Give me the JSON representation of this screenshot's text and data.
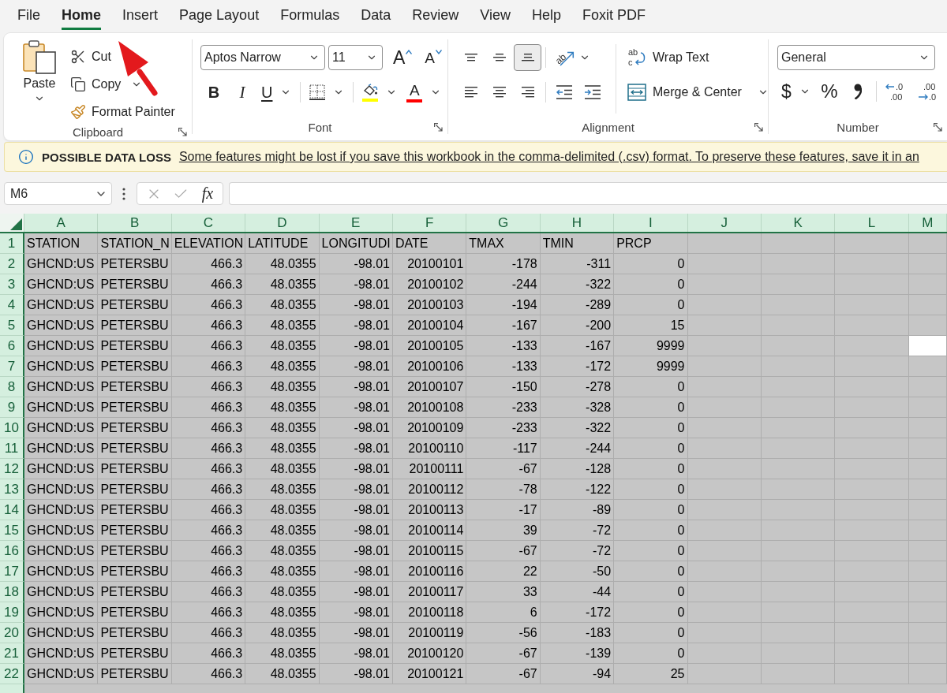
{
  "menu_tabs": [
    {
      "label": "File",
      "selected": false
    },
    {
      "label": "Home",
      "selected": true
    },
    {
      "label": "Insert",
      "selected": false
    },
    {
      "label": "Page Layout",
      "selected": false
    },
    {
      "label": "Formulas",
      "selected": false
    },
    {
      "label": "Data",
      "selected": false
    },
    {
      "label": "Review",
      "selected": false
    },
    {
      "label": "View",
      "selected": false
    },
    {
      "label": "Help",
      "selected": false
    },
    {
      "label": "Foxit PDF",
      "selected": false
    }
  ],
  "ribbon": {
    "clipboard": {
      "title": "Clipboard",
      "paste": {
        "label": "Paste",
        "dropdown": true
      },
      "actions": [
        {
          "kind": "cut",
          "label": "Cut",
          "dropdown": false
        },
        {
          "kind": "copy",
          "label": "Copy",
          "dropdown": true
        },
        {
          "kind": "format_painter",
          "label": "Format Painter",
          "dropdown": false
        }
      ]
    },
    "font": {
      "title": "Font",
      "font_name": "Aptos Narrow",
      "font_size": "11",
      "size_buttons": [
        {
          "kind": "grow",
          "glyph": "A"
        },
        {
          "kind": "shrink",
          "glyph": "A"
        }
      ],
      "format_buttons": [
        {
          "kind": "bold",
          "glyph": "B",
          "dropdown": false
        },
        {
          "kind": "italic",
          "glyph": "I",
          "dropdown": false
        },
        {
          "kind": "underline",
          "glyph": "U",
          "dropdown": true
        },
        {
          "kind": "borders",
          "dropdown": true
        },
        {
          "kind": "fill_color",
          "color": "#ffff00",
          "dropdown": true
        },
        {
          "kind": "font_color",
          "glyph": "A",
          "color": "#ff0000",
          "dropdown": true
        }
      ]
    },
    "alignment": {
      "title": "Alignment",
      "top_row": [
        {
          "kind": "align_top",
          "selected": false
        },
        {
          "kind": "align_middle",
          "selected": false
        },
        {
          "kind": "align_bottom",
          "selected": true
        },
        {
          "kind": "orientation",
          "glyph": "ab",
          "selected": false,
          "dropdown": true
        }
      ],
      "bottom_row": [
        {
          "kind": "align_left",
          "selected": false
        },
        {
          "kind": "align_center",
          "selected": false
        },
        {
          "kind": "align_right",
          "selected": false
        },
        {
          "kind": "decrease_indent",
          "selected": false
        },
        {
          "kind": "increase_indent",
          "selected": false
        }
      ],
      "wrap_text": {
        "label": "Wrap Text",
        "glyphs": [
          "ab",
          "c"
        ]
      },
      "merge": {
        "label": "Merge & Center",
        "dropdown": true
      }
    },
    "number": {
      "title": "Number",
      "format": "General",
      "buttons": [
        {
          "kind": "currency",
          "glyph": "$",
          "dropdown": true
        },
        {
          "kind": "percent",
          "glyph": "%",
          "dropdown": false
        },
        {
          "kind": "comma",
          "dropdown": false
        },
        {
          "kind": "increase_decimal",
          "glyphs": [
            ".0",
            ".00"
          ],
          "dropdown": false
        },
        {
          "kind": "decrease_decimal",
          "glyphs": [
            ".00",
            ".0"
          ],
          "dropdown": false
        }
      ]
    }
  },
  "message_bar": {
    "title": "POSSIBLE DATA LOSS",
    "message": "Some features might be lost if you save this workbook in the comma-delimited (.csv) format. To preserve these features, save it in an"
  },
  "formula_bar": {
    "name_box": "M6",
    "buttons": [
      {
        "kind": "cancel",
        "disabled": true
      },
      {
        "kind": "enter",
        "disabled": true
      },
      {
        "kind": "insert_function",
        "glyph": "fx",
        "disabled": false
      }
    ]
  },
  "sheet": {
    "columns": [
      {
        "label": "A",
        "kind": "text",
        "selected": true,
        "active": false
      },
      {
        "label": "B",
        "kind": "text",
        "selected": true,
        "active": false
      },
      {
        "label": "C",
        "kind": "number",
        "selected": true,
        "active": false
      },
      {
        "label": "D",
        "kind": "number",
        "selected": true,
        "active": false
      },
      {
        "label": "E",
        "kind": "number",
        "selected": true,
        "active": false
      },
      {
        "label": "F",
        "kind": "number",
        "selected": true,
        "active": false
      },
      {
        "label": "G",
        "kind": "number",
        "selected": true,
        "active": false
      },
      {
        "label": "H",
        "kind": "number",
        "selected": true,
        "active": false
      },
      {
        "label": "I",
        "kind": "number",
        "selected": true,
        "active": false
      },
      {
        "label": "J",
        "kind": "text",
        "selected": true,
        "active": false
      },
      {
        "label": "K",
        "kind": "text",
        "selected": true,
        "active": false
      },
      {
        "label": "L",
        "kind": "text",
        "selected": true,
        "active": false
      },
      {
        "label": "M",
        "kind": "text",
        "selected": true,
        "active": true
      }
    ],
    "rows": [
      {
        "number": "1",
        "kind": "header",
        "selected": true,
        "active": false,
        "values": [
          "STATION",
          "STATION_N",
          "ELEVATION",
          "LATITUDE",
          "LONGITUDI",
          "DATE",
          "TMAX",
          "TMIN",
          "PRCP"
        ]
      },
      {
        "number": "2",
        "kind": "data",
        "selected": true,
        "active": false,
        "values": [
          "GHCND:US",
          "PETERSBU",
          "466.3",
          "48.0355",
          "-98.01",
          "20100101",
          "-178",
          "-311",
          "0"
        ]
      },
      {
        "number": "3",
        "kind": "data",
        "selected": true,
        "active": false,
        "values": [
          "GHCND:US",
          "PETERSBU",
          "466.3",
          "48.0355",
          "-98.01",
          "20100102",
          "-244",
          "-322",
          "0"
        ]
      },
      {
        "number": "4",
        "kind": "data",
        "selected": true,
        "active": false,
        "values": [
          "GHCND:US",
          "PETERSBU",
          "466.3",
          "48.0355",
          "-98.01",
          "20100103",
          "-194",
          "-289",
          "0"
        ]
      },
      {
        "number": "5",
        "kind": "data",
        "selected": true,
        "active": false,
        "values": [
          "GHCND:US",
          "PETERSBU",
          "466.3",
          "48.0355",
          "-98.01",
          "20100104",
          "-167",
          "-200",
          "15"
        ]
      },
      {
        "number": "6",
        "kind": "data",
        "selected": true,
        "active": true,
        "values": [
          "GHCND:US",
          "PETERSBU",
          "466.3",
          "48.0355",
          "-98.01",
          "20100105",
          "-133",
          "-167",
          "9999"
        ]
      },
      {
        "number": "7",
        "kind": "data",
        "selected": true,
        "active": false,
        "values": [
          "GHCND:US",
          "PETERSBU",
          "466.3",
          "48.0355",
          "-98.01",
          "20100106",
          "-133",
          "-172",
          "9999"
        ]
      },
      {
        "number": "8",
        "kind": "data",
        "selected": true,
        "active": false,
        "values": [
          "GHCND:US",
          "PETERSBU",
          "466.3",
          "48.0355",
          "-98.01",
          "20100107",
          "-150",
          "-278",
          "0"
        ]
      },
      {
        "number": "9",
        "kind": "data",
        "selected": true,
        "active": false,
        "values": [
          "GHCND:US",
          "PETERSBU",
          "466.3",
          "48.0355",
          "-98.01",
          "20100108",
          "-233",
          "-328",
          "0"
        ]
      },
      {
        "number": "10",
        "kind": "data",
        "selected": true,
        "active": false,
        "values": [
          "GHCND:US",
          "PETERSBU",
          "466.3",
          "48.0355",
          "-98.01",
          "20100109",
          "-233",
          "-322",
          "0"
        ]
      },
      {
        "number": "11",
        "kind": "data",
        "selected": true,
        "active": false,
        "values": [
          "GHCND:US",
          "PETERSBU",
          "466.3",
          "48.0355",
          "-98.01",
          "20100110",
          "-117",
          "-244",
          "0"
        ]
      },
      {
        "number": "12",
        "kind": "data",
        "selected": true,
        "active": false,
        "values": [
          "GHCND:US",
          "PETERSBU",
          "466.3",
          "48.0355",
          "-98.01",
          "20100111",
          "-67",
          "-128",
          "0"
        ]
      },
      {
        "number": "13",
        "kind": "data",
        "selected": true,
        "active": false,
        "values": [
          "GHCND:US",
          "PETERSBU",
          "466.3",
          "48.0355",
          "-98.01",
          "20100112",
          "-78",
          "-122",
          "0"
        ]
      },
      {
        "number": "14",
        "kind": "data",
        "selected": true,
        "active": false,
        "values": [
          "GHCND:US",
          "PETERSBU",
          "466.3",
          "48.0355",
          "-98.01",
          "20100113",
          "-17",
          "-89",
          "0"
        ]
      },
      {
        "number": "15",
        "kind": "data",
        "selected": true,
        "active": false,
        "values": [
          "GHCND:US",
          "PETERSBU",
          "466.3",
          "48.0355",
          "-98.01",
          "20100114",
          "39",
          "-72",
          "0"
        ]
      },
      {
        "number": "16",
        "kind": "data",
        "selected": true,
        "active": false,
        "values": [
          "GHCND:US",
          "PETERSBU",
          "466.3",
          "48.0355",
          "-98.01",
          "20100115",
          "-67",
          "-72",
          "0"
        ]
      },
      {
        "number": "17",
        "kind": "data",
        "selected": true,
        "active": false,
        "values": [
          "GHCND:US",
          "PETERSBU",
          "466.3",
          "48.0355",
          "-98.01",
          "20100116",
          "22",
          "-50",
          "0"
        ]
      },
      {
        "number": "18",
        "kind": "data",
        "selected": true,
        "active": false,
        "values": [
          "GHCND:US",
          "PETERSBU",
          "466.3",
          "48.0355",
          "-98.01",
          "20100117",
          "33",
          "-44",
          "0"
        ]
      },
      {
        "number": "19",
        "kind": "data",
        "selected": true,
        "active": false,
        "values": [
          "GHCND:US",
          "PETERSBU",
          "466.3",
          "48.0355",
          "-98.01",
          "20100118",
          "6",
          "-172",
          "0"
        ]
      },
      {
        "number": "20",
        "kind": "data",
        "selected": true,
        "active": false,
        "values": [
          "GHCND:US",
          "PETERSBU",
          "466.3",
          "48.0355",
          "-98.01",
          "20100119",
          "-56",
          "-183",
          "0"
        ]
      },
      {
        "number": "21",
        "kind": "data",
        "selected": true,
        "active": false,
        "values": [
          "GHCND:US",
          "PETERSBU",
          "466.3",
          "48.0355",
          "-98.01",
          "20100120",
          "-67",
          "-139",
          "0"
        ]
      },
      {
        "number": "22",
        "kind": "data",
        "selected": true,
        "active": false,
        "values": [
          "GHCND:US",
          "PETERSBU",
          "466.3",
          "48.0355",
          "-98.01",
          "20100121",
          "-67",
          "-94",
          "25"
        ]
      }
    ]
  },
  "annotations": [
    {
      "kind": "arrow"
    }
  ]
}
